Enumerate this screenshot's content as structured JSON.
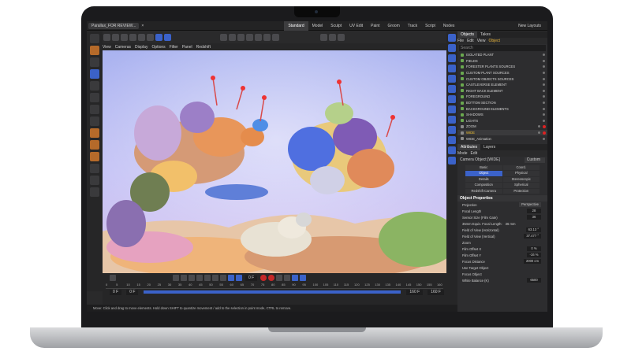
{
  "window": {
    "tab_title": "Parallax_FOR REVIEW..."
  },
  "layouts": {
    "items": [
      "Standard",
      "Model",
      "Sculpt",
      "UV Edit",
      "Paint",
      "Groom",
      "Track",
      "Script",
      "Nodes"
    ],
    "active": "Standard",
    "new_layouts": "New Layouts"
  },
  "viewport_menu": [
    "View",
    "Cameras",
    "Display",
    "Options",
    "Filter",
    "Panel",
    "Redshift"
  ],
  "objects_panel": {
    "tabs": [
      "Objects",
      "Takes"
    ],
    "menu": [
      "File",
      "Edit",
      "View",
      "Object"
    ],
    "search_placeholder": "Search",
    "items": [
      "ISOLATED PLANT",
      "FIELDS",
      "FORESTER PLANTS SOURCES",
      "CUSTOM PLANT SOURCES",
      "CUSTOM OBJECTS SOURCES",
      "CASTLEVERSE ELEMENT",
      "RIGHT BACK ELEMENT",
      "FOREGROUND",
      "BOTTOM SECTION",
      "BACKGROUND ELEMENTS",
      "SHADOWS",
      "LIGHTS",
      "ZOOM",
      "WIDE",
      "WIDE_Animation"
    ],
    "selected": "WIDE"
  },
  "attributes_panel": {
    "tabs": [
      "Attributes",
      "Layers"
    ],
    "menu": [
      "Mode",
      "Edit"
    ],
    "camera_label": "Camera Object [WIDE]",
    "camera_mode": "Custom",
    "tabs_grid": [
      "Basic",
      "Coord.",
      "Object",
      "Physical",
      "Details",
      "Stereoscopic",
      "Composition",
      "Spherical",
      "Redshift Camera",
      "Protection"
    ],
    "active_tab": "Object",
    "section_title": "Object Properties",
    "properties": [
      {
        "label": "Projection",
        "value": "Perspective",
        "kind": "select"
      },
      {
        "label": "Focal Length",
        "value": "28",
        "kind": "field"
      },
      {
        "label": "Sensor Size (Film Gate)",
        "value": "36",
        "kind": "field"
      },
      {
        "label": "35mm Equiv. Focal Length:",
        "value": "36 mm",
        "kind": "text"
      },
      {
        "label": "Field of View (Horizontal)",
        "value": "63.13 °",
        "kind": "field"
      },
      {
        "label": "Field of View (Vertical)",
        "value": "37.477 °",
        "kind": "field"
      },
      {
        "label": "Zoom",
        "value": "",
        "kind": "text"
      },
      {
        "label": "Film Offset X",
        "value": "0 %",
        "kind": "field"
      },
      {
        "label": "Film Offset Y",
        "value": "-16 %",
        "kind": "field"
      },
      {
        "label": "Focus Distance",
        "value": "2000 cm",
        "kind": "field"
      },
      {
        "label": "Use Target Object",
        "value": "",
        "kind": "text"
      },
      {
        "label": "Focus Object",
        "value": "",
        "kind": "text"
      },
      {
        "label": "White Balance (K)",
        "value": "6500",
        "kind": "field"
      }
    ]
  },
  "timeline": {
    "frame": "0 F",
    "ruler": [
      "0",
      "5",
      "10",
      "15",
      "20",
      "25",
      "30",
      "35",
      "40",
      "45",
      "50",
      "55",
      "60",
      "65",
      "70",
      "75",
      "80",
      "85",
      "90",
      "95",
      "100",
      "105",
      "110",
      "115",
      "120",
      "125",
      "130",
      "135",
      "140",
      "145",
      "150",
      "155",
      "160"
    ],
    "start": "0 F",
    "start2": "0 F",
    "end": "160 F",
    "end2": "160 F"
  },
  "status": "Move: Click and drag to move elements. Hold down SHIFT to quantize movement / add to the selection in point mode, CTRL to remove."
}
